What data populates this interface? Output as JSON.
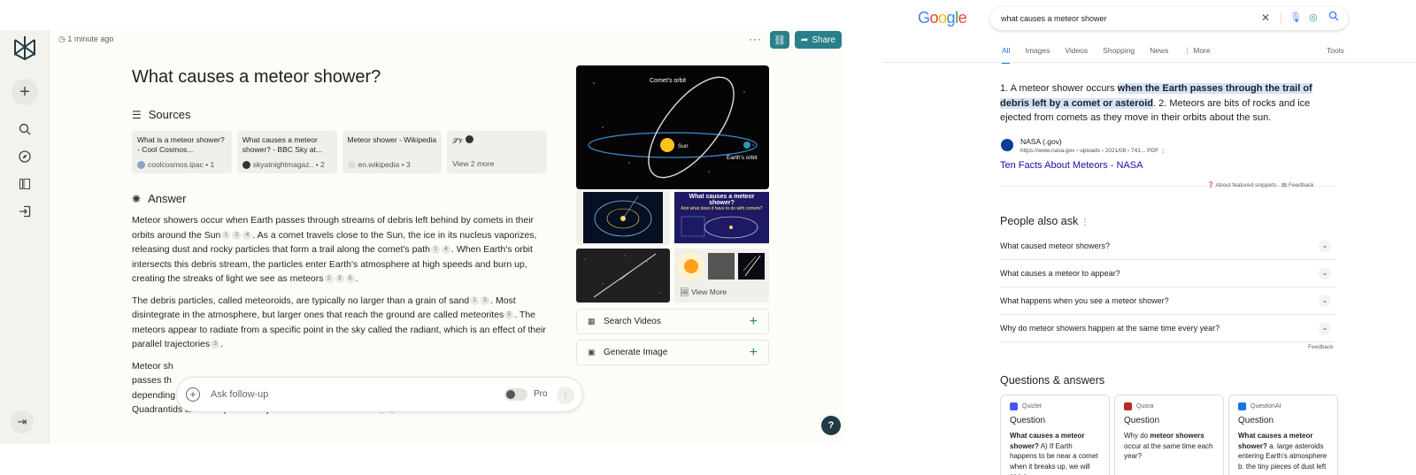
{
  "left_app": {
    "time_ago": "1 minute ago",
    "share_label": "Share",
    "question": "What causes a meteor shower?",
    "sources_heading": "Sources",
    "sources": [
      {
        "title": "What is a meteor shower? - Cool Cosmos...",
        "meta": "coolcosmos.ipac • 1"
      },
      {
        "title": "What causes a meteor shower? - BBC Sky at...",
        "meta": "skyatnightmagaz.. • 2"
      },
      {
        "title": "Meteor shower - Wikipedia",
        "meta": "en.wikipedia • 3"
      }
    ],
    "view_more_sources": "View 2 more",
    "answer_heading": "Answer",
    "answer_p1": {
      "a": "Meteor showers occur when Earth passes through streams of debris left behind by comets in their orbits around the Sun",
      "c1": [
        "1",
        "2",
        "4"
      ],
      "b": ". As a comet travels close to the Sun, the ice in its nucleus vaporizes, releasing dust and rocky particles that form a trail along the comet's path",
      "c2": [
        "1",
        "4"
      ],
      "c": ". When Earth's orbit intersects this debris stream, the particles enter Earth's atmosphere at high speeds and burn up, creating the streaks of light we see as meteors",
      "c3": [
        "2",
        "3",
        "5"
      ],
      "d": "."
    },
    "answer_p2": {
      "a": "The debris particles, called meteoroids, are typically no larger than a grain of sand",
      "c1": [
        "1",
        "5"
      ],
      "b": ". Most disintegrate in the atmosphere, but larger ones that reach the ground are called meteorites",
      "c2": [
        "5"
      ],
      "c": ". The meteors appear to radiate from a specific point in the sky called the radiant, which is an effect of their parallel trajectories",
      "c3": [
        "3"
      ],
      "d": "."
    },
    "answer_p3_partial": [
      "Meteor sh",
      "passes th",
      "depending"
    ],
    "answer_p3_last": "Quadrantids are examples of major annual meteor showers",
    "answer_p3_cites": [
      "2",
      "3"
    ],
    "followup_placeholder": "Ask follow-up",
    "pro_label": "Pro",
    "diagram_labels": {
      "comet_orbit": "Comet's orbit",
      "sun": "Sun",
      "earth_orbit": "Earth's orbit"
    },
    "thumb2_title": "What causes a meteor shower?",
    "thumb2_subtitle": "And what does it have to do with comets?",
    "view_more_images": "View More",
    "search_videos": "Search Videos",
    "generate_image": "Generate Image",
    "help": "?"
  },
  "google": {
    "logo": "Google",
    "query": "what causes a meteor shower",
    "tabs": [
      "All",
      "Images",
      "Videos",
      "Shopping",
      "News",
      "More"
    ],
    "tools": "Tools",
    "snippet_pre": "1. A meteor shower occurs ",
    "snippet_highlight": "when the Earth passes through the trail of debris left by a comet or asteroid",
    "snippet_post": ". 2. Meteors are bits of rocks and ice ejected from comets as they move in their orbits about the sun.",
    "source_name": "NASA (.gov)",
    "source_url": "https://www.nasa.gov › uploads › 2021/08 › 741... PDF",
    "result_title": "Ten Facts About Meteors - NASA",
    "about_snippets": "About featured snippets",
    "feedback": "Feedback",
    "paa_title": "People also ask",
    "paa": [
      "What caused meteor showers?",
      "What causes a meteor to appear?",
      "What happens when you see a meteor shower?",
      "Why do meteor showers happen at the same time every year?"
    ],
    "qa_title": "Questions & answers",
    "qa_cards": [
      {
        "source": "Quizlet",
        "heading": "Question",
        "bold": "What causes a meteor shower?",
        "rest": " A) If Earth happens to be near a comet when it breaks up, we will see a",
        "color": "#4255ff"
      },
      {
        "source": "Quora",
        "heading": "Question",
        "pre": "Why do ",
        "bold": "meteor showers",
        "rest": " occur at the same time each year?",
        "color": "#b92b27"
      },
      {
        "source": "QuestionAI",
        "heading": "Question",
        "bold": "What causes a meteor shower?",
        "rest": " a. large asteroids entering Earth's atmosphere b. the tiny pieces of dust left",
        "color": "#1a73e8"
      }
    ]
  }
}
